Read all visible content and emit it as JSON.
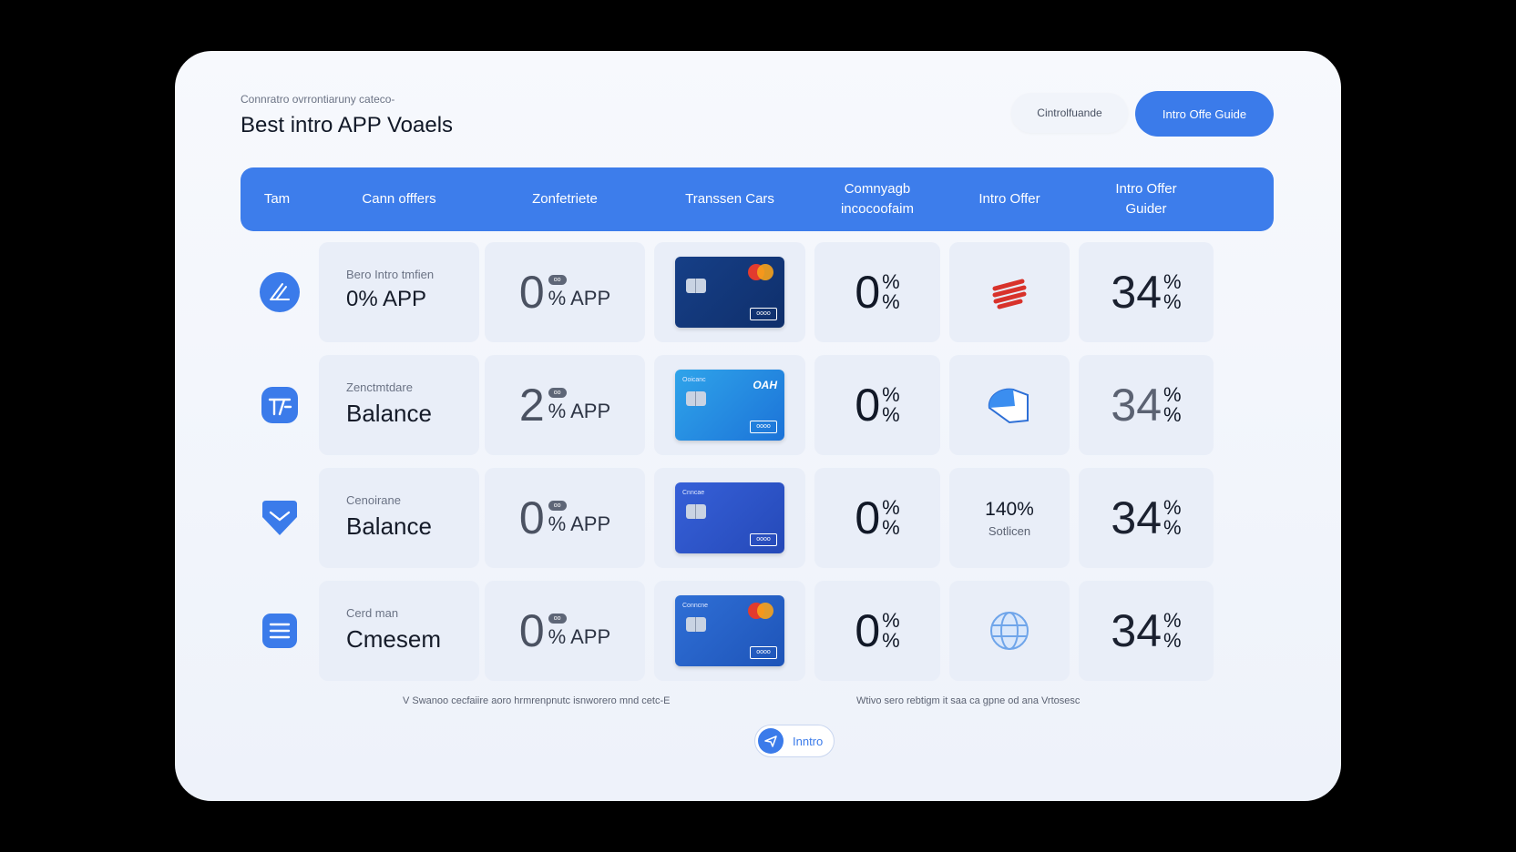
{
  "header": {
    "subtitle": "Connratro ovrrontiaruny cateco-",
    "title": "Best intro APP Voaels",
    "secondary_button": "Cintrolfuande",
    "primary_button": "Intro Offe Guide"
  },
  "table": {
    "columns": [
      "Tam",
      "Cann offfers",
      "Zonfetriete",
      "Transsen Cars",
      "Comnyagb incocoofaim",
      "Intro Offer",
      "Intro Offer Guider"
    ],
    "rows": [
      {
        "icon": "pen-circle-icon",
        "name_sub": "Bero Intro tmfien",
        "name": "0% APP",
        "rate_big": "0",
        "rate_pill": "oo",
        "rate_unit": "% APP",
        "card_style": "navy-mastercard",
        "card_text": "",
        "card_brand": "",
        "card_badge": "oooo",
        "pct_big": "0",
        "pct_small": "%",
        "offer_icon": "red-stripes-icon",
        "offer_num": "",
        "offer_sub": "",
        "rate2_big": "34",
        "rate2_small": "%"
      },
      {
        "icon": "chart-square-icon",
        "name_sub": "Zenctmtdare",
        "name": "Balance",
        "rate_big": "2",
        "rate_pill": "oo",
        "rate_unit": "% APP",
        "card_style": "sky-brand",
        "card_text": "Ooicanc",
        "card_brand": "OAH",
        "card_badge": "oooo",
        "pct_big": "0",
        "pct_small": "%",
        "offer_icon": "half-disc-icon",
        "offer_num": "",
        "offer_sub": "",
        "rate2_big": "34",
        "rate2_small": "%"
      },
      {
        "icon": "heart-icon",
        "name_sub": "Cenoirane",
        "name": "Balance",
        "rate_big": "0",
        "rate_pill": "oo",
        "rate_unit": "% APP",
        "card_style": "indigo-plain",
        "card_text": "Cnncae",
        "card_brand": "",
        "card_badge": "oooo",
        "pct_big": "0",
        "pct_small": "%",
        "offer_icon": "",
        "offer_num": "140%",
        "offer_sub": "Sotlicen",
        "rate2_big": "34",
        "rate2_small": "%"
      },
      {
        "icon": "menu-lines-icon",
        "name_sub": "Cerd man",
        "name": "Cmesem",
        "rate_big": "0",
        "rate_pill": "oo",
        "rate_unit": "% APP",
        "card_style": "blue-mastercard",
        "card_text": "Conncne",
        "card_brand": "",
        "card_badge": "oooo",
        "pct_big": "0",
        "pct_small": "%",
        "offer_icon": "globe-icon",
        "offer_num": "",
        "offer_sub": "",
        "rate2_big": "34",
        "rate2_small": "%"
      }
    ]
  },
  "footer": {
    "left_text": "V Swanoo cecfaiire aoro hrmrenpnutc isnworero mnd cetc-E",
    "pill_label": "Inntro",
    "right_text": "Wtivo sero rebtigm it saa ca gpne od ana Vrtosesc"
  },
  "colors": {
    "accent": "#3d7deb",
    "panel": "#f4f7fc",
    "cell": "#e9eef8"
  }
}
